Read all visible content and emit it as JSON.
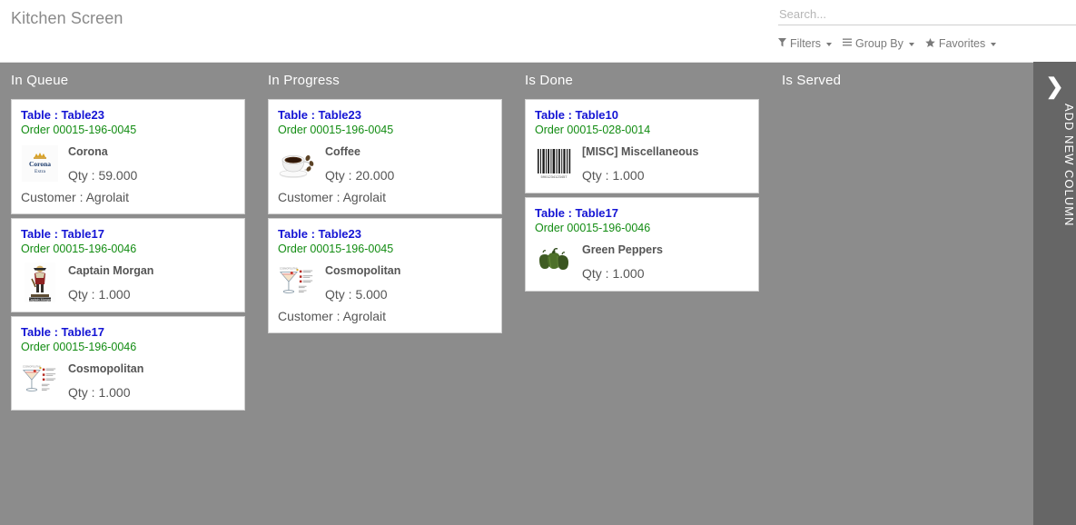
{
  "app": {
    "breadcrumb": "Kitchen Screen"
  },
  "search": {
    "value": "",
    "placeholder": "Search..."
  },
  "toolbar": {
    "filters_label": "Filters",
    "filters_icon": "filter-funnel-icon",
    "groupby_label": "Group By",
    "groupby_icon": "list-lines-icon",
    "favorites_label": "Favorites",
    "favorites_icon": "star-icon"
  },
  "add_column": {
    "label": "ADD NEW COLUMN",
    "chevron": "❯"
  },
  "colors": {
    "board_background": "#8c8c8c",
    "rail_background": "#666666",
    "table_text": "#1414d4",
    "order_text": "#128c12",
    "body_text": "#555555",
    "header_text": "#ffffff",
    "breadcrumb_text": "#8a8a8a"
  },
  "board": {
    "columns": [
      {
        "id": "in-queue",
        "title": "In Queue",
        "cards": [
          {
            "table": "Table : Table23",
            "order": "Order 00015-196-0045",
            "product": "Corona",
            "qty": "Qty : 59.000",
            "customer": "Customer : Agrolait",
            "thumb": "corona-beer-logo-image"
          },
          {
            "table": "Table : Table17",
            "order": "Order 00015-196-0046",
            "product": "Captain Morgan",
            "qty": "Qty : 1.000",
            "customer": "",
            "thumb": "captain-morgan-rum-image"
          },
          {
            "table": "Table : Table17",
            "order": "Order 00015-196-0046",
            "product": "Cosmopolitan",
            "qty": "Qty : 1.000",
            "customer": "",
            "thumb": "cosmopolitan-cocktail-image"
          }
        ]
      },
      {
        "id": "in-progress",
        "title": "In Progress",
        "cards": [
          {
            "table": "Table : Table23",
            "order": "Order 00015-196-0045",
            "product": "Coffee",
            "qty": "Qty : 20.000",
            "customer": "Customer : Agrolait",
            "thumb": "coffee-cup-image"
          },
          {
            "table": "Table : Table23",
            "order": "Order 00015-196-0045",
            "product": "Cosmopolitan",
            "qty": "Qty : 5.000",
            "customer": "Customer : Agrolait",
            "thumb": "cosmopolitan-cocktail-image"
          }
        ]
      },
      {
        "id": "is-done",
        "title": "Is Done",
        "cards": [
          {
            "table": "Table : Table10",
            "order": "Order 00015-028-0014",
            "product": "[MISC] Miscellaneous",
            "qty": "Qty : 1.000",
            "customer": "",
            "thumb": "barcode-placeholder-image"
          },
          {
            "table": "Table : Table17",
            "order": "Order 00015-196-0046",
            "product": "Green Peppers",
            "qty": "Qty : 1.000",
            "customer": "",
            "thumb": "green-peppers-image"
          }
        ]
      },
      {
        "id": "is-served",
        "title": "Is Served",
        "cards": []
      }
    ]
  }
}
